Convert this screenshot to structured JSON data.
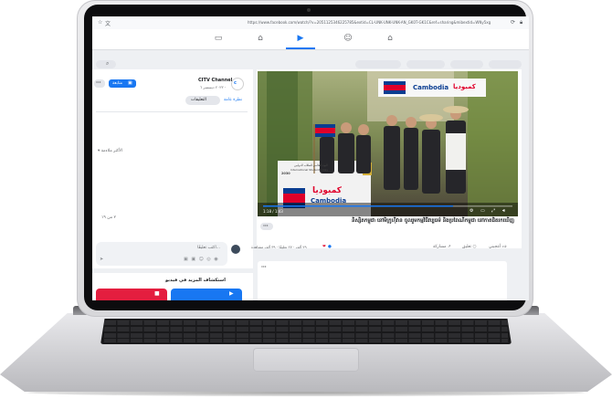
{
  "browser": {
    "url": "https://www.facebook.com/watch/?v=2051125346225785&extid=CL-UNK-UNK-UNK-AN_GK0T-GK1C&ref=sharing&mibextid=WNy5xg"
  },
  "nav": {
    "icons": [
      "gaming-icon",
      "marketplace-icon",
      "watch-icon",
      "friends-icon",
      "home-icon"
    ],
    "active": "watch-icon"
  },
  "video": {
    "time": "1:18 / 1:43",
    "banner_top_ar": "كمبوديا",
    "banner_top_en": "Cambodia",
    "banner_stand_ar": "كمبوديا",
    "banner_stand_en": "Cambodia",
    "event_ar": "اليوم العالمي للطلاب الدوليين",
    "event_en": "International Students' Day",
    "event_year": "2030"
  },
  "post": {
    "title": "និស្សិតកម្ពុជា នៅមិក្រូហ៊ីវាន ចូលរួមកម្មវិធីវប្បធម៌ និងប្រពៃណីកម្ពុជា នៅកាតជិត​រកឃើញ",
    "reactions": "٢٩ ألف · ٢٧ تعليقًا · ٣٩ ألف مشاهدة",
    "like_label": "أعجبني",
    "comment_label": "تعليق",
    "share_label": "مشاركة",
    "more_label": "···"
  },
  "channel": {
    "name": "CITV Channel",
    "date": "٢٠٢٣ ديسمبر ٦ ·",
    "follow_label": "متابعة",
    "more_label": "···",
    "tab_overview": "نظرة عامة",
    "tab_comments": "التعليقات",
    "sort_label": "الأكثر ملاءمة",
    "count_label": "٢ من ١٩",
    "comment_placeholder": "اكتب تعليقًا...",
    "explore_label": "استكشاف المزيد في فيديو"
  },
  "colors": {
    "accent": "#1877f2",
    "red": "#e41e3f"
  }
}
